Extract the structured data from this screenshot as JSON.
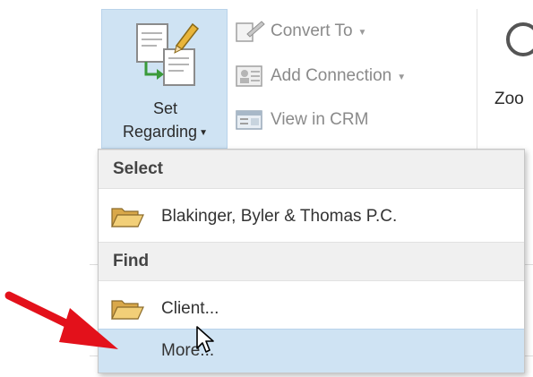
{
  "ribbon": {
    "set_regarding": {
      "line1": "Set",
      "line2": "Regarding",
      "icon": "set-regarding-icon"
    },
    "commands": [
      {
        "label": "Convert To",
        "icon": "convert-icon",
        "has_dropdown": true,
        "enabled": false
      },
      {
        "label": "Add Connection",
        "icon": "connection-icon",
        "has_dropdown": true,
        "enabled": false
      },
      {
        "label": "View in CRM",
        "icon": "crm-icon",
        "has_dropdown": false,
        "enabled": false
      }
    ],
    "zoom_label": "Zoo"
  },
  "menu": {
    "select_header": "Select",
    "select_items": [
      {
        "label": "Blakinger, Byler & Thomas P.C.",
        "icon": "folder-icon"
      }
    ],
    "find_header": "Find",
    "find_items": [
      {
        "label": "Client...",
        "icon": "folder-icon"
      },
      {
        "label": "More...",
        "highlighted": true
      }
    ]
  },
  "colors": {
    "highlight": "#cfe3f3",
    "arrow": "#e3111b"
  }
}
